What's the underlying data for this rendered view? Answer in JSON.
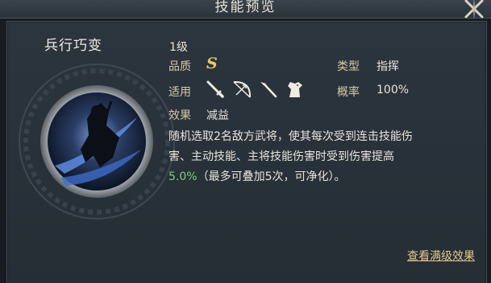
{
  "header": {
    "title": "技能预览"
  },
  "skill": {
    "name": "兵行巧变",
    "level": "1级",
    "quality_label": "品质",
    "quality_value": "S",
    "type_label": "类型",
    "type_value": "指挥",
    "apply_label": "适用",
    "applicable_units": [
      "sword-icon",
      "bow-icon",
      "spear-icon",
      "horse-icon"
    ],
    "rate_label": "概率",
    "rate_value": "100%",
    "effect_label": "效果",
    "effect_value": "减益",
    "description_line1": "随机选取2名敌方武将，使其每次受到连击技能伤",
    "description_line2": "害、主动技能、主将技能伤害时受到伤害提高",
    "description_pct": "5.0%",
    "description_tail": "（最多可叠加5次，可净化）。"
  },
  "footer": {
    "full_effect_link": "查看满级效果"
  },
  "colors": {
    "label": "#d7c9a6",
    "quality": "#e8c86a",
    "highlight_pct": "#7bcf7a",
    "link": "#e2c98b"
  }
}
